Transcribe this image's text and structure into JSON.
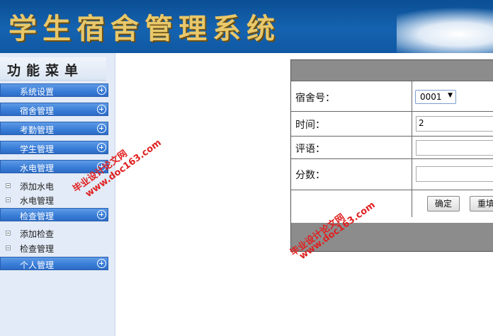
{
  "app": {
    "title": "学生宿舍管理系统"
  },
  "sidebar": {
    "menu_title": "功能菜单",
    "sections": [
      {
        "label": "系统设置",
        "items": []
      },
      {
        "label": "宿舍管理",
        "items": []
      },
      {
        "label": "考勤管理",
        "items": []
      },
      {
        "label": "学生管理",
        "items": []
      },
      {
        "label": "水电管理",
        "items": [
          {
            "label": "添加水电"
          },
          {
            "label": "水电管理"
          }
        ]
      },
      {
        "label": "检查管理",
        "items": [
          {
            "label": "添加检查"
          },
          {
            "label": "检查管理"
          }
        ]
      },
      {
        "label": "个人管理",
        "items": []
      }
    ]
  },
  "form": {
    "dorm_label": "宿舍号：",
    "dorm_value": "0001",
    "time_label": "时间：",
    "time_value": "2",
    "comment_label": "评语：",
    "score_label": "分数：",
    "confirm_label": "确定",
    "reset_label": "重填"
  },
  "watermark": {
    "text_cn": "毕业设计论文网",
    "text_url": "www.doc163.com"
  }
}
